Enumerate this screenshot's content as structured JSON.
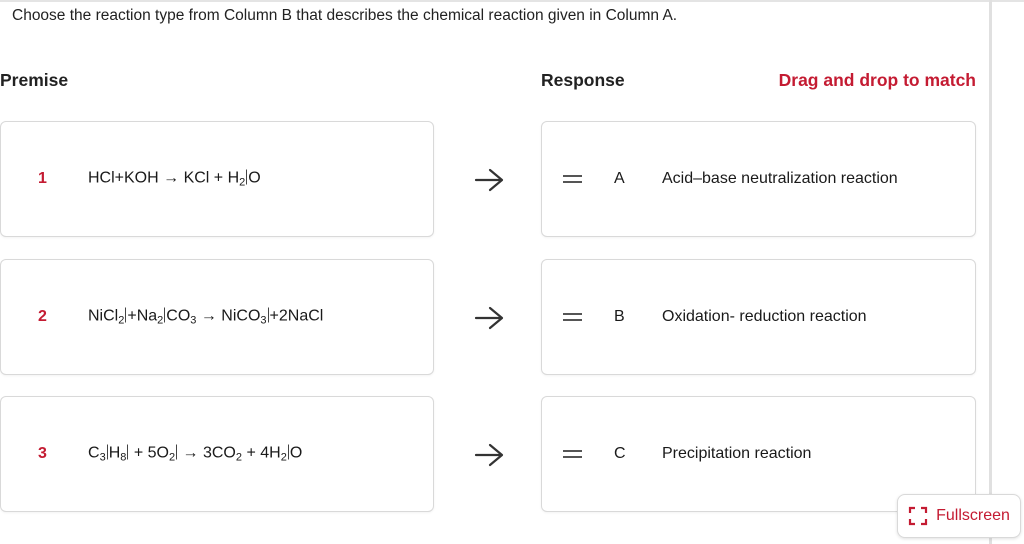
{
  "question": "Choose the reaction type from Column B that describes the chemical reaction given in Column A.",
  "headers": {
    "premise": "Premise",
    "response": "Response",
    "instruction": "Drag and drop to match"
  },
  "premises": [
    {
      "number": "1",
      "equation": {
        "p1": "HCl+KOH → KCl + H",
        "s1": "2",
        "p2": "O"
      }
    },
    {
      "number": "2",
      "equation": {
        "p1": "NiCl",
        "s1": "2",
        "p2": "+Na",
        "s2": "2",
        "p3": "CO",
        "s3": "3",
        "p4": " → NiCO",
        "s4": "3",
        "p5": "+2NaCl"
      }
    },
    {
      "number": "3",
      "equation": {
        "p1": "C",
        "s1": "3",
        "p2": "H",
        "s2": "8",
        "p3": " + 5O",
        "s3": "2",
        "p4": " → 3CO",
        "s4": "2",
        "p5": " + 4H",
        "s5": "2",
        "p6": "O"
      }
    }
  ],
  "responses": [
    {
      "letter": "A",
      "text": "Acid–base neutralization reaction"
    },
    {
      "letter": "B",
      "text": "Oxidation- reduction reaction"
    },
    {
      "letter": "C",
      "text": "Precipitation reaction"
    }
  ],
  "fullscreen": {
    "label": "Fullscreen",
    "icon": "fullscreen-icon"
  },
  "colors": {
    "accent": "#c41b32",
    "border": "#d9d9d9",
    "text": "#222222"
  }
}
